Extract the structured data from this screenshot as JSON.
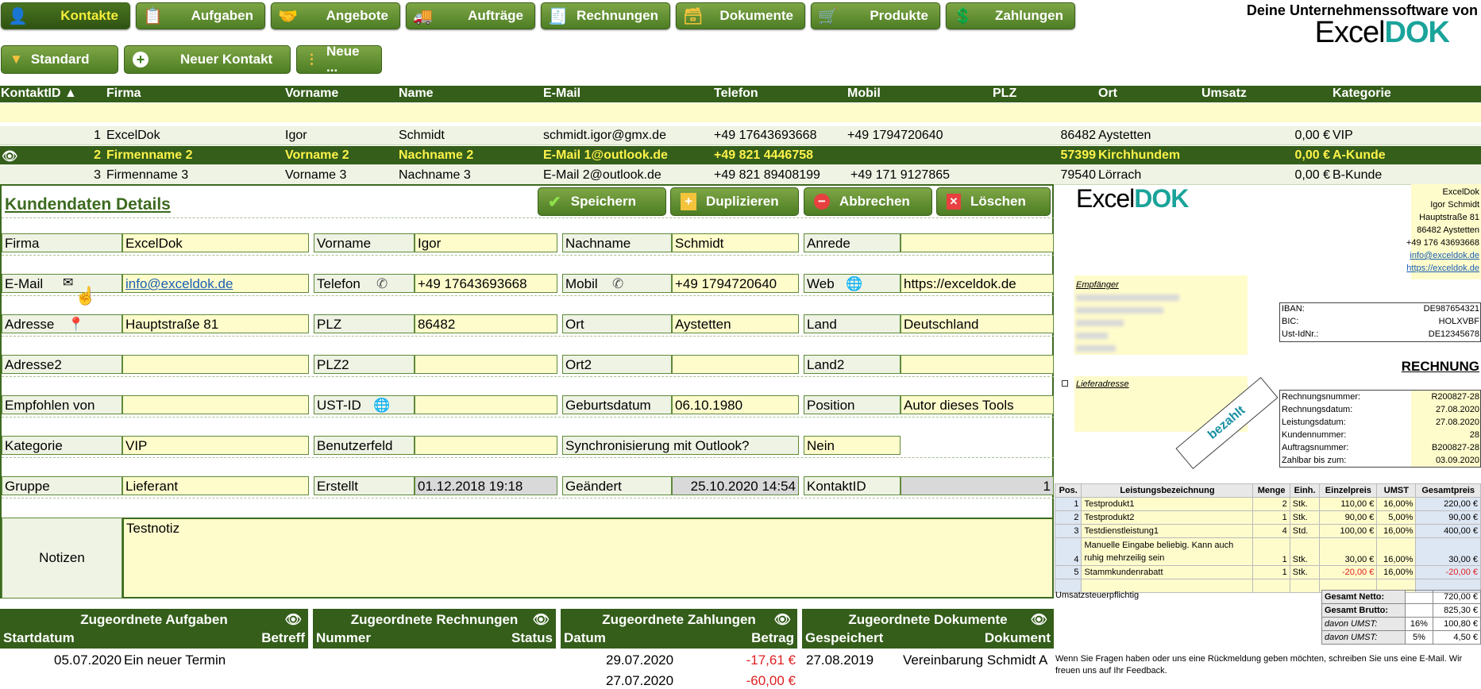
{
  "nav": {
    "tabs": [
      {
        "label": "Kontakte",
        "icon": "contacts-icon",
        "active": true
      },
      {
        "label": "Aufgaben",
        "icon": "tasks-icon"
      },
      {
        "label": "Angebote",
        "icon": "offers-icon"
      },
      {
        "label": "Aufträge",
        "icon": "truck-icon"
      },
      {
        "label": "Rechnungen",
        "icon": "invoice-icon"
      },
      {
        "label": "Dokumente",
        "icon": "documents-icon"
      },
      {
        "label": "Produkte",
        "icon": "cart-icon"
      },
      {
        "label": "Zahlungen",
        "icon": "payments-icon"
      }
    ],
    "brand_tagline": "Deine Unternehmenssoftware von",
    "brand_excel": "Excel",
    "brand_dok": "DOK"
  },
  "toolbar": {
    "standard": "Standard",
    "new_contact": "Neuer Kontakt",
    "new_more": "Neue ..."
  },
  "table": {
    "headers": [
      "KontaktID ▲",
      "Firma",
      "Vorname",
      "Name",
      "E-Mail",
      "Telefon",
      "Mobil",
      "PLZ",
      "Ort",
      "Umsatz",
      "Kategorie"
    ],
    "rows": [
      [
        "1",
        "ExcelDok",
        "Igor",
        "Schmidt",
        "schmidt.igor@gmx.de",
        "+49 17643693668",
        "+49 1794720640",
        "86482",
        "Aystetten",
        "0,00 €",
        "VIP"
      ],
      [
        "2",
        "Firmenname 2",
        "Vorname 2",
        "Nachname 2",
        "E-Mail 1@outlook.de",
        "+49 821 4446758",
        "",
        "57399",
        "Kirchhundem",
        "0,00 €",
        "A-Kunde"
      ],
      [
        "3",
        "Firmenname 3",
        "Vorname 3",
        "Nachname 3",
        "E-Mail 2@outlook.de",
        "+49 821 89408199",
        "+49 171 9127865",
        "79540",
        "Lörrach",
        "0,00 €",
        "B-Kunde"
      ]
    ]
  },
  "detail": {
    "title": "Kundendaten Details",
    "save": "Speichern",
    "duplicate": "Duplizieren",
    "cancel": "Abbrechen",
    "delete": "Löschen",
    "firma_l": "Firma",
    "firma": "ExcelDok",
    "vorname_l": "Vorname",
    "vorname": "Igor",
    "nachname_l": "Nachname",
    "nachname": "Schmidt",
    "anrede_l": "Anrede",
    "anrede": "",
    "email_l": "E-Mail",
    "email": "info@exceldok.de",
    "telefon_l": "Telefon",
    "telefon": "+49 17643693668",
    "mobil_l": "Mobil",
    "mobil": "+49 1794720640",
    "web_l": "Web",
    "web": "https://exceldok.de",
    "adresse_l": "Adresse",
    "adresse": "Hauptstraße 81",
    "plz_l": "PLZ",
    "plz": "86482",
    "ort_l": "Ort",
    "ort": "Aystetten",
    "land_l": "Land",
    "land": "Deutschland",
    "adresse2_l": "Adresse2",
    "plz2_l": "PLZ2",
    "ort2_l": "Ort2",
    "land2_l": "Land2",
    "empfohlen_l": "Empfohlen von",
    "ustid_l": "UST-ID",
    "geburt_l": "Geburtsdatum",
    "geburt": "06.10.1980",
    "position_l": "Position",
    "position": "Autor dieses Tools",
    "kategorie_l": "Kategorie",
    "kategorie": "VIP",
    "benutzer_l": "Benutzerfeld",
    "sync_l": "Synchronisierung mit Outlook?",
    "sync": "Nein",
    "gruppe_l": "Gruppe",
    "gruppe": "Lieferant",
    "erstellt_l": "Erstellt",
    "erstellt": "01.12.2018 19:18",
    "geaendert_l": "Geändert",
    "geaendert": "25.10.2020 14:54",
    "kid_l": "KontaktID",
    "kid": "1",
    "notizen_l": "Notizen",
    "notizen": "Testnotiz"
  },
  "sections": {
    "aufgaben": {
      "title": "Zugeordnete Aufgaben",
      "l": "Startdatum",
      "r": "Betreff",
      "date": "05.07.2020",
      "text": "Ein neuer Termin"
    },
    "rechnungen": {
      "title": "Zugeordnete Rechnungen",
      "l": "Nummer",
      "r": "Status"
    },
    "zahlungen": {
      "title": "Zugeordnete Zahlungen",
      "l": "Datum",
      "r": "Betrag",
      "d1": "29.07.2020",
      "a1": "-17,61 €",
      "d2": "27.07.2020",
      "a2": "-60,00 €"
    },
    "dokumente": {
      "title": "Zugeordnete Dokumente",
      "l": "Gespeichert",
      "r": "Dokument",
      "date": "27.08.2019",
      "text": "Vereinbarung Schmidt A"
    }
  },
  "invoice": {
    "logo_excel": "Excel",
    "logo_dok": "DOK",
    "sender": [
      "ExcelDok",
      "Igor Schmidt",
      "Hauptstraße 81",
      "86482 Aystetten",
      "+49 176 43693668",
      "info@exceldok.de",
      "https://exceldok.de"
    ],
    "empfaenger": "Empfänger",
    "lieferadresse": "Lieferadresse",
    "iban_l": "IBAN:",
    "iban": "DE987654321",
    "bic_l": "BIC:",
    "bic": "HOLXVBF",
    "ust_l": "Ust-IdNr.:",
    "ust": "DE12345678",
    "title": "RECHNUNG",
    "meta": [
      [
        "Rechnungsnummer:",
        "R200827-28"
      ],
      [
        "Rechnungsdatum:",
        "27.08.2020"
      ],
      [
        "Leistungsdatum:",
        "27.08.2020"
      ],
      [
        "Kundennummer:",
        "28"
      ],
      [
        "Auftragsnummer:",
        "B200827-28"
      ],
      [
        "Zahlbar bis zum:",
        "03.09.2020"
      ]
    ],
    "stamp": "bezahlt",
    "item_headers": [
      "Pos.",
      "Leistungsbezeichnung",
      "Menge",
      "Einh.",
      "Einzelpreis",
      "UMST",
      "Gesamtpreis"
    ],
    "items": [
      [
        "1",
        "Testprodukt1",
        "2",
        "Stk.",
        "110,00 €",
        "16,00%",
        "220,00 €"
      ],
      [
        "2",
        "Testprodukt2",
        "1",
        "Stk.",
        "90,00 €",
        "5,00%",
        "90,00 €"
      ],
      [
        "3",
        "Testdienstleistung1",
        "4",
        "Std.",
        "100,00 €",
        "16,00%",
        "400,00 €"
      ],
      [
        "4",
        "Manuelle Eingabe beliebig. Kann auch ruhig mehrzeilig sein",
        "1",
        "Stk.",
        "30,00 €",
        "16,00%",
        "30,00 €"
      ],
      [
        "5",
        "Stammkundenrabatt",
        "1",
        "Stk.",
        "-20,00 €",
        "16,00%",
        "-20,00 €"
      ]
    ],
    "ust_note": "Umsatzsteuerpflichtig",
    "totals": [
      [
        "Gesamt Netto:",
        "",
        "720,00 €"
      ],
      [
        "Gesamt Brutto:",
        "",
        "825,30 €"
      ],
      [
        "davon UMST:",
        "16%",
        "100,80 €"
      ],
      [
        "davon UMST:",
        "5%",
        "4,50 €"
      ]
    ],
    "footer": "Wenn Sie Fragen haben oder uns eine Rückmeldung geben möchten, schreiben Sie uns eine E-Mail. Wir freuen uns auf Ihr Feedback."
  },
  "colors": {
    "accent": "#345e1a",
    "highlight": "#fff34a",
    "field": "#fffccc",
    "brand_dok": "#1aa39a"
  }
}
